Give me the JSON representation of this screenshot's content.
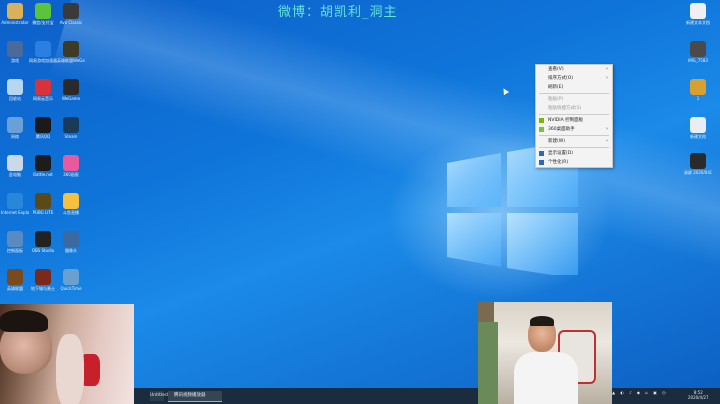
{
  "watermark": "微博：胡凯利_洞主",
  "desktop_icons_left": [
    {
      "id": "i1",
      "label": "Administrator",
      "color": "#d8b25a"
    },
    {
      "id": "i2",
      "label": "微信/支付宝",
      "color": "#5cc43b"
    },
    {
      "id": "i3",
      "label": "Ava Classic",
      "color": "#3a3a3a"
    },
    {
      "id": "i4",
      "label": "游戏",
      "color": "#4a6a9a"
    },
    {
      "id": "i5",
      "label": "网易游戏加速器",
      "color": "#2a7fe0"
    },
    {
      "id": "i6",
      "label": "英雄联盟WeGame",
      "color": "#3d3a25"
    },
    {
      "id": "i7",
      "label": "回收站",
      "color": "#b9d6f0"
    },
    {
      "id": "i8",
      "label": "网易云音乐",
      "color": "#d8323a"
    },
    {
      "id": "i9",
      "label": "WeGame",
      "color": "#2a2a2a"
    },
    {
      "id": "i10",
      "label": "网络",
      "color": "#6aa0d8"
    },
    {
      "id": "i11",
      "label": "腾讯QQ",
      "color": "#1a1a1a"
    },
    {
      "id": "i12",
      "label": "Steam",
      "color": "#1b3a5a"
    },
    {
      "id": "i13",
      "label": "此电脑",
      "color": "#c9d9e9"
    },
    {
      "id": "i14",
      "label": "Battle.net",
      "color": "#1c1c1c"
    },
    {
      "id": "i15",
      "label": "360画报",
      "color": "#e85aa0"
    },
    {
      "id": "i16",
      "label": "Internet Explorer",
      "color": "#2a86d8"
    },
    {
      "id": "i17",
      "label": "PUBG LITE",
      "color": "#5a4a1a"
    },
    {
      "id": "i18",
      "label": "斗鱼直播",
      "color": "#f4c040"
    },
    {
      "id": "i19",
      "label": "控制面板",
      "color": "#5a8ac0"
    },
    {
      "id": "i20",
      "label": "OBS Studio",
      "color": "#222"
    },
    {
      "id": "i21",
      "label": "摄像头",
      "color": "#3a6aa0"
    },
    {
      "id": "i22",
      "label": "英雄联盟",
      "color": "#7a4a1a"
    },
    {
      "id": "i23",
      "label": "地下城与勇士",
      "color": "#7a2a1a"
    },
    {
      "id": "i24",
      "label": "QuickTime",
      "color": "#6aa0d0"
    }
  ],
  "desktop_icons_right": [
    {
      "id": "r1",
      "label": "新建文本文档",
      "color": "#f0f0f0"
    },
    {
      "id": "r2",
      "label": "IMG_7583",
      "color": "#4a4a4a"
    },
    {
      "id": "r3",
      "label": "1",
      "color": "#d8a030"
    },
    {
      "id": "r4",
      "label": "新建文档",
      "color": "#e8eef4"
    },
    {
      "id": "r5",
      "label": "录屏 2020/04/27",
      "color": "#2a2a2a"
    }
  ],
  "context_menu": [
    {
      "label": "查看(V)",
      "arrow": true
    },
    {
      "label": "排序方式(O)",
      "arrow": true
    },
    {
      "label": "刷新(E)",
      "arrow": false
    },
    {
      "sep": true
    },
    {
      "label": "粘贴(P)",
      "disabled": true
    },
    {
      "label": "粘贴快捷方式(S)",
      "disabled": true
    },
    {
      "sep": true
    },
    {
      "label": "NVIDIA 控制面板",
      "icon": "#76b900"
    },
    {
      "label": "360桌面助手",
      "icon": "#7ac040",
      "arrow": true
    },
    {
      "sep": true
    },
    {
      "label": "新建(W)",
      "arrow": true
    },
    {
      "sep": true
    },
    {
      "label": "显示设置(D)",
      "icon": "#2a6ac0"
    },
    {
      "label": "个性化(R)",
      "icon": "#2a6ac0"
    }
  ],
  "taskbar": {
    "items": [
      "Untitled",
      "腾讯视频播放器"
    ],
    "time": "8:52",
    "date": "2020/4/27"
  }
}
